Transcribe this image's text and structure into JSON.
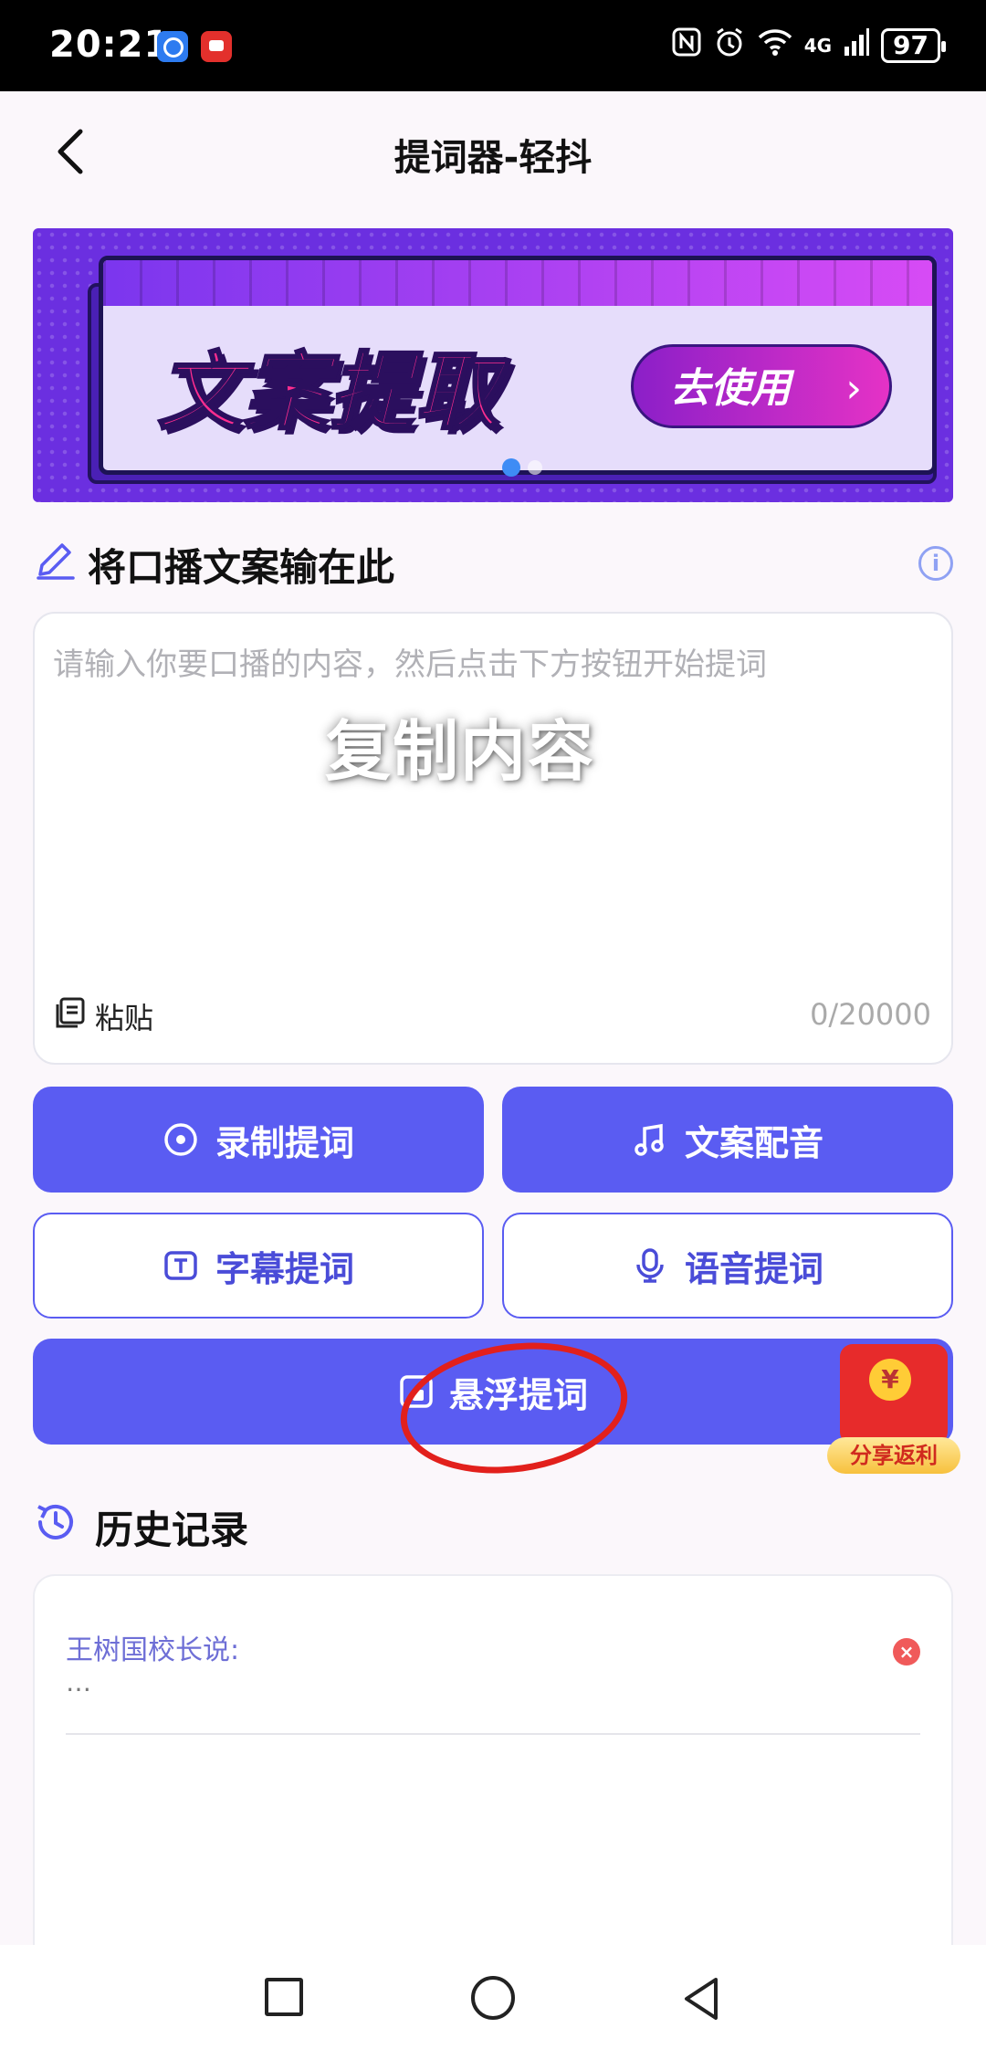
{
  "status_bar": {
    "time": "20:21",
    "network": "4G",
    "battery": "97"
  },
  "header": {
    "title": "提词器-轻抖"
  },
  "banner": {
    "headline": "文案提取",
    "cta": "去使用",
    "cta_arrow": "›"
  },
  "editor": {
    "section_title": "将口播文案输在此",
    "placeholder": "请输入你要口播的内容，然后点击下方按钮开始提词",
    "overlay": "复制内容",
    "paste_label": "粘贴",
    "counter": "0/20000"
  },
  "actions": {
    "record": "录制提词",
    "dubbing": "文案配音",
    "subtitle": "字幕提词",
    "voice": "语音提词",
    "floating": "悬浮提词"
  },
  "promo": {
    "coin": "¥",
    "label": "分享返利"
  },
  "history": {
    "title": "历史记录",
    "items": [
      {
        "title": "王树国校长说:",
        "body": "…"
      }
    ]
  },
  "colors": {
    "primary": "#5a5cf2",
    "banner": "#6b2fe0",
    "annotation": "#e2201c"
  }
}
